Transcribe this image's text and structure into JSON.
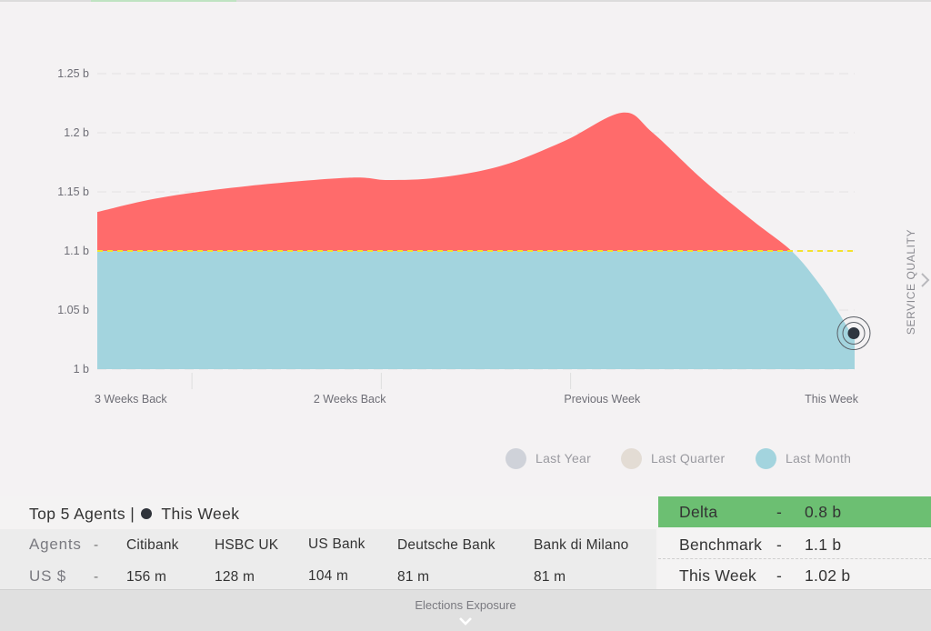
{
  "side_label": "SERVICE QUALITY",
  "chart_data": {
    "type": "area",
    "y_tick_labels": [
      "1.25 b",
      "1.2 b",
      "1.15 b",
      "1.1 b",
      "1.05 b",
      "1 b"
    ],
    "ylim": [
      1.0,
      1.25
    ],
    "x_tick_labels": [
      "3 Weeks Back",
      "2 Weeks Back",
      "Previous Week",
      "This Week"
    ],
    "x_positions": [
      0,
      1,
      2,
      3
    ],
    "benchmark": 1.1,
    "series": [
      {
        "values": [
          1.133,
          1.145,
          1.155,
          1.162,
          1.16,
          1.162,
          1.172,
          1.193,
          1.217,
          1.2,
          1.16,
          1.125,
          1.1,
          1.075,
          1.05,
          1.025
        ],
        "x": [
          0,
          0.25,
          0.6,
          1.0,
          1.15,
          1.35,
          1.6,
          1.85,
          2.08,
          2.2,
          2.4,
          2.6,
          2.75,
          2.85,
          2.93,
          3.0
        ]
      }
    ],
    "current_value": 1.025,
    "colors": {
      "above": "#ff6b6b",
      "below": "#a3d4de",
      "benchmark_line": "#f4e22e"
    },
    "grid": true
  },
  "legend": [
    {
      "label": "Last Year",
      "color": "#cfd2d9"
    },
    {
      "label": "Last Quarter",
      "color": "#e3dcd4"
    },
    {
      "label": "Last Month",
      "color": "#a3d4de"
    }
  ],
  "agents": {
    "title": "Top 5 Agents |",
    "title_suffix": "This Week",
    "row_labels": [
      "Agents",
      "US $"
    ],
    "sep": "-",
    "names": [
      "Citibank",
      "HSBC UK",
      "US Bank",
      "Deutsche Bank",
      "Bank di Milano"
    ],
    "amounts": [
      "156 m",
      "128 m",
      "104 m",
      "81 m",
      "81 m"
    ]
  },
  "metrics": [
    {
      "label": "Delta",
      "value": "0.8 b"
    },
    {
      "label": "Benchmark",
      "value": "1.1 b"
    },
    {
      "label": "This Week",
      "value": "1.02 b"
    }
  ],
  "footer": {
    "label": "Elections Exposure"
  }
}
